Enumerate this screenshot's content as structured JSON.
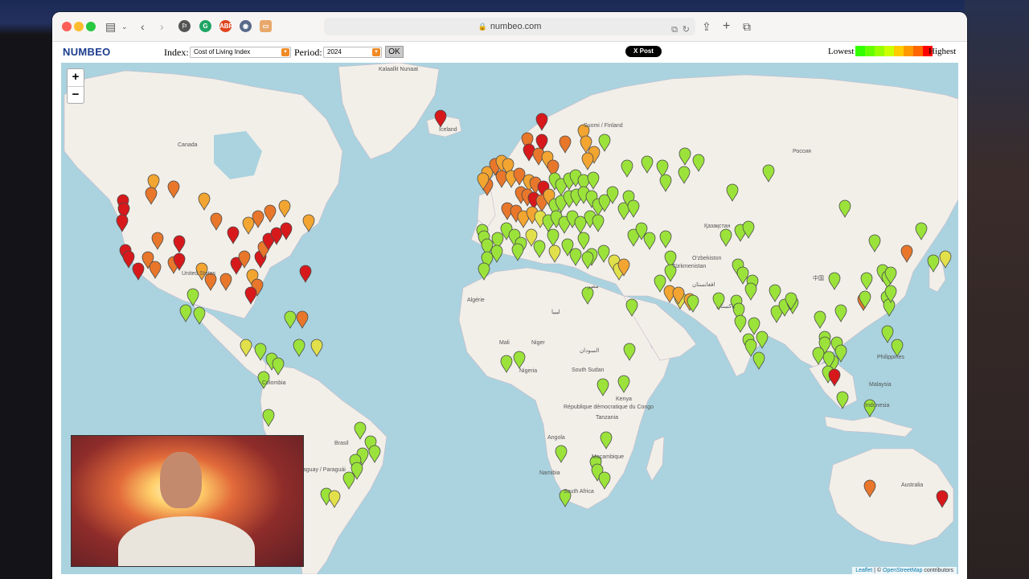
{
  "browser": {
    "url": "numbeo.com"
  },
  "site": {
    "logo": "NUMBEO",
    "index_label": "Index:",
    "index_value": "Cost of Living Index",
    "period_label": "Period:",
    "period_value": "2024",
    "ok_label": "OK",
    "post_label": "X Post",
    "legend_lowest": "Lowest",
    "legend_highest": "Highest",
    "legend_colors": [
      "#33ff00",
      "#66ff00",
      "#99ff00",
      "#ccff00",
      "#ffcc00",
      "#ff9900",
      "#ff6600",
      "#ff0000"
    ]
  },
  "map": {
    "zoom_in": "+",
    "zoom_out": "−",
    "attribution_leaflet": "Leaflet",
    "attribution_sep": " | © ",
    "attribution_osm": "OpenStreetMap",
    "attribution_tail": " contributors",
    "labels": [
      "Kalaallit Nunaat",
      "Canada",
      "United States",
      "Suomi / Finland",
      "Россия",
      "Қазақстан",
      "O'zbekiston",
      "Türkmenistan",
      "افغانستان",
      "پاکستان",
      "中国",
      "Algérie",
      "Mali",
      "Niger",
      "Nigeria",
      "السودان",
      "South Sudan",
      "Kenya",
      "République démocratique du Congo",
      "Tanzania",
      "Angola",
      "Namibia",
      "Moçambique",
      "South Africa",
      "Colombia",
      "Brasil",
      "Paraguay / Paraguái",
      "Australia",
      "Indonesia",
      "Malaysia",
      "Philippines",
      "مصر",
      "ليبيا",
      "Iceland"
    ],
    "marker_colors": {
      "red": "#d7191c",
      "orange": "#e8772b",
      "amber": "#f2a531",
      "yellow": "#e2e04a",
      "lime": "#9be33a",
      "green": "#58d934"
    }
  }
}
